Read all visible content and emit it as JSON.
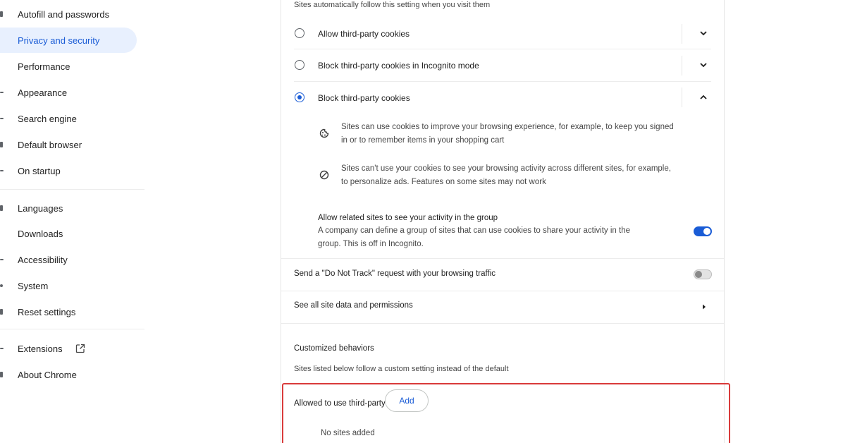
{
  "sidebar": {
    "items": [
      {
        "label": "Autofill and passwords",
        "active": false
      },
      {
        "label": "Privacy and security",
        "active": true
      },
      {
        "label": "Performance",
        "active": false
      },
      {
        "label": "Appearance",
        "active": false
      },
      {
        "label": "Search engine",
        "active": false
      },
      {
        "label": "Default browser",
        "active": false
      },
      {
        "label": "On startup",
        "active": false
      },
      {
        "label": "Languages",
        "active": false
      },
      {
        "label": "Downloads",
        "active": false
      },
      {
        "label": "Accessibility",
        "active": false
      },
      {
        "label": "System",
        "active": false
      },
      {
        "label": "Reset settings",
        "active": false
      },
      {
        "label": "Extensions",
        "active": false
      },
      {
        "label": "About Chrome",
        "active": false
      }
    ],
    "extensions_icon": "open-in-new-icon"
  },
  "cookies": {
    "intro": "Sites automatically follow this setting when you visit them",
    "options": [
      {
        "label": "Allow third-party cookies",
        "selected": false,
        "expanded": false
      },
      {
        "label": "Block third-party cookies in Incognito mode",
        "selected": false,
        "expanded": false
      },
      {
        "label": "Block third-party cookies",
        "selected": true,
        "expanded": true
      }
    ],
    "details": [
      {
        "icon": "cookie-icon",
        "line1": "Sites can use cookies to improve your browsing experience, for example, to keep you signed",
        "line2": "in or to remember items in your shopping cart"
      },
      {
        "icon": "block-icon",
        "line1": "Sites can't use your cookies to see your browsing activity across different sites, for example,",
        "line2": "to personalize ads. Features on some sites may not work"
      }
    ],
    "related_sites": {
      "title": "Allow related sites to see your activity in the group",
      "desc_line1": "A company can define a group of sites that can use cookies to share your activity in the",
      "desc_line2": "group. This is off in Incognito.",
      "enabled": true
    }
  },
  "do_not_track": {
    "label": "Send a \"Do Not Track\" request with your browsing traffic",
    "enabled": false
  },
  "site_data": {
    "label": "See all site data and permissions"
  },
  "customized": {
    "heading": "Customized behaviors",
    "desc": "Sites listed below follow a custom setting instead of the default",
    "allowed_label": "Allowed to use third-party cookies",
    "add_label": "Add",
    "empty": "No sites added"
  },
  "colors": {
    "accent": "#1a5cd6",
    "active_bg": "#e8f0fe",
    "highlight": "#d93b3b"
  }
}
